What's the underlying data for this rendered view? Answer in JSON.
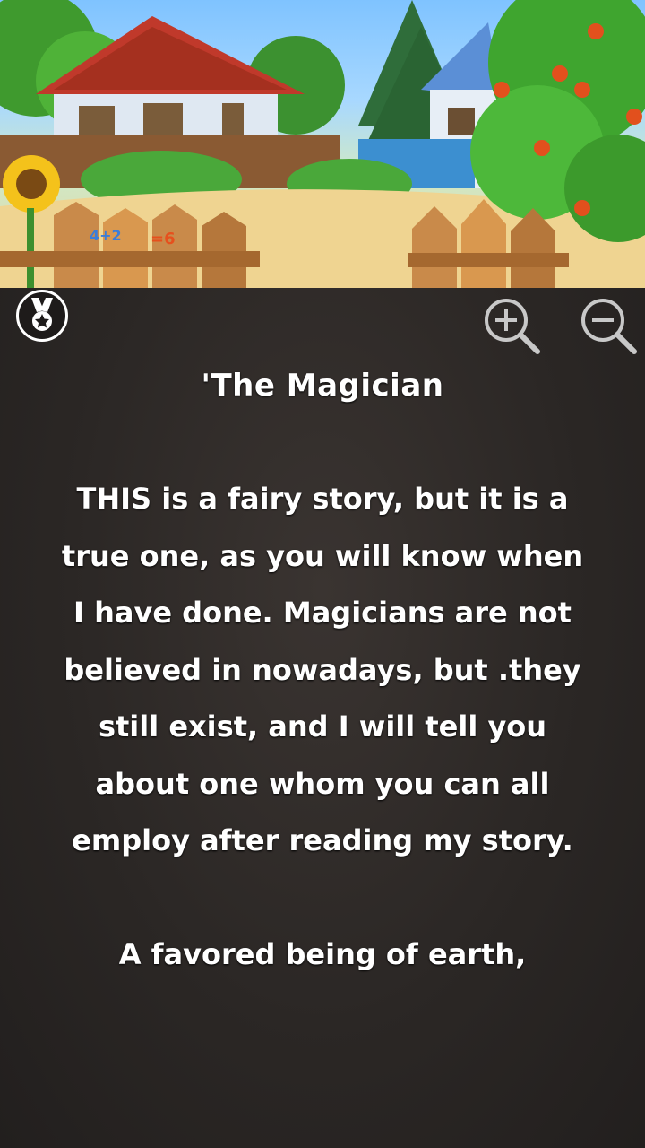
{
  "header": {
    "illustration": "cartoon-village-scene",
    "sign_left_text": "4+2",
    "sign_right_text": "=6"
  },
  "toolbar": {
    "badge_icon": "medal-icon",
    "zoom_in_icon": "zoom-in-icon",
    "zoom_out_icon": "zoom-out-icon"
  },
  "story": {
    "title": "'The Magician",
    "paragraph_1": "THIS is a fairy story, but it is a true one, as you will know when I have done. Magicians are not believed in nowadays, but .they still exist, and I will tell you about one whom you can all employ after reading my story.",
    "paragraph_2": "A favored being of earth,"
  },
  "colors": {
    "panel_background": "#2b2725",
    "text": "#ffffff",
    "icon": "#c8c8c8"
  }
}
